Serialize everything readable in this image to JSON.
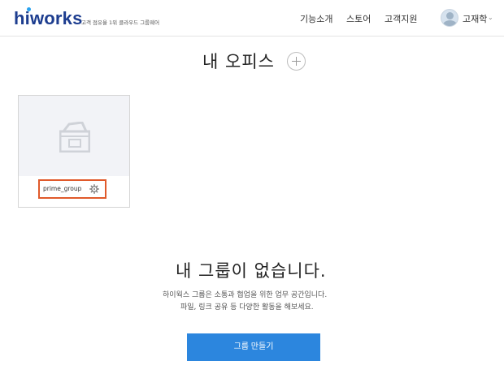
{
  "header": {
    "logo": {
      "h": "h",
      "i": "i",
      "works": "works"
    },
    "tagline": "고객 점유율 1위 클라우드 그룹웨어",
    "nav": [
      "기능소개",
      "스토어",
      "고객지원"
    ],
    "user": {
      "name": "고재학",
      "chevron": "⌄"
    }
  },
  "main": {
    "title": "내 오피스",
    "office_card": {
      "name": "prime_group"
    },
    "empty": {
      "title": "내 그룹이 없습니다.",
      "desc_line1": "하이웍스 그룹은 소통과 협업을 위한 업무 공간입니다.",
      "desc_line2": "파일, 링크 공유 등 다양한 활동을 해보세요.",
      "button_label": "그룹 만들기"
    }
  },
  "colors": {
    "logo": "#1d3d8f",
    "logo_dot": "#29a3ef",
    "primary_button": "#2c86de",
    "highlight_border": "#e05a2b"
  },
  "icons": {
    "add": "plus-circle-icon",
    "card": "box-icon",
    "settings": "gear-icon",
    "avatar": "user-avatar-icon"
  }
}
